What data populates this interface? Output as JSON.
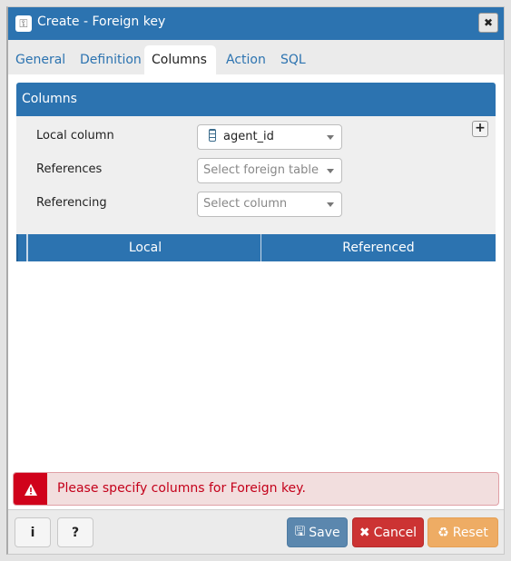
{
  "dialog": {
    "title": "Create - Foreign key",
    "title_icon": "key-icon",
    "close_icon": "close-icon",
    "close_glyph": "✖"
  },
  "tabs": [
    {
      "label": "General",
      "active": false
    },
    {
      "label": "Definition",
      "active": false
    },
    {
      "label": "Columns",
      "active": true
    },
    {
      "label": "Action",
      "active": false
    },
    {
      "label": "SQL",
      "active": false
    }
  ],
  "panel": {
    "header": "Columns",
    "add_glyph": "+",
    "fields": [
      {
        "label": "Local column",
        "value": "agent_id",
        "placeholder": "",
        "icon": "column-icon"
      },
      {
        "label": "References",
        "value": "",
        "placeholder": "Select foreign table"
      },
      {
        "label": "Referencing",
        "value": "",
        "placeholder": "Select column"
      }
    ],
    "grid": {
      "columns": [
        "Local",
        "Referenced"
      ],
      "rows": []
    }
  },
  "error": {
    "icon": "warning-icon",
    "glyph": "▲",
    "message": "Please specify columns for Foreign key.",
    "color": "#d0021b"
  },
  "footer": {
    "info_label": "i",
    "help_label": "?",
    "save_label": "Save",
    "cancel_label": "Cancel",
    "reset_label": "Reset",
    "save_glyph": "🖫",
    "cancel_glyph": "✖",
    "reset_glyph": "♻"
  },
  "colors": {
    "primary": "#2c73b0",
    "save": "#5b87ae",
    "cancel": "#cc3333",
    "reset": "#eeac64"
  }
}
